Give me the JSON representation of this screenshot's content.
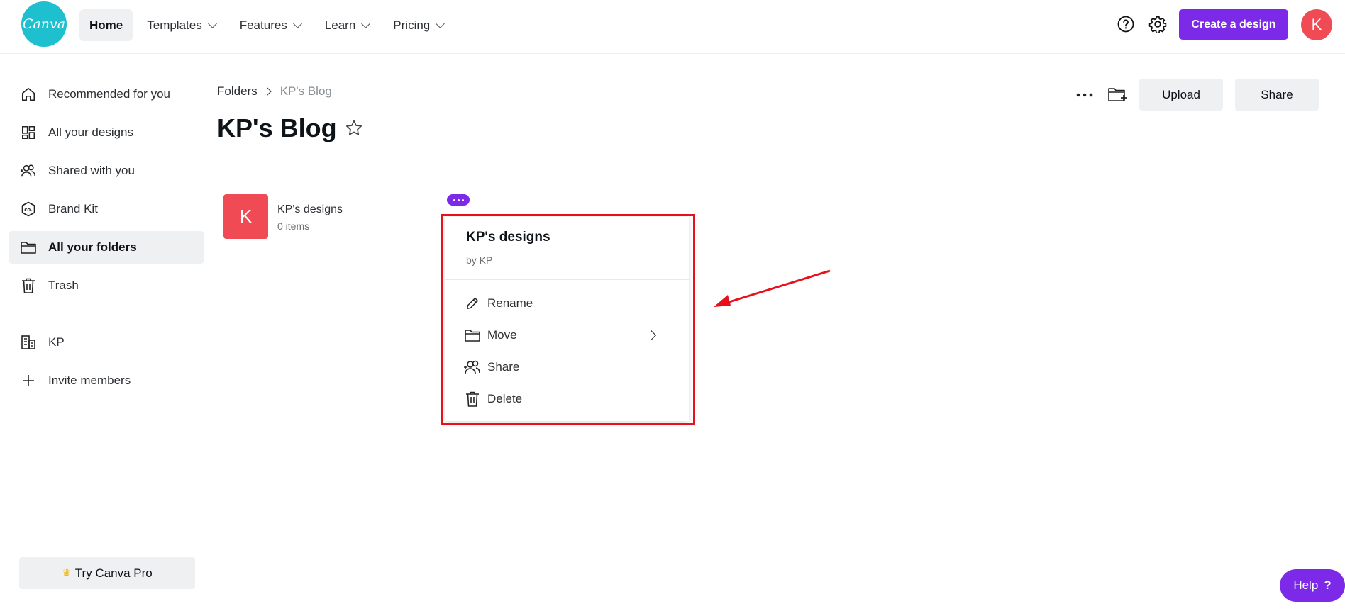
{
  "brand": {
    "logo_text": "Canva"
  },
  "nav": {
    "home": "Home",
    "templates": "Templates",
    "features": "Features",
    "learn": "Learn",
    "pricing": "Pricing"
  },
  "header": {
    "create_label": "Create a design",
    "avatar_initial": "K"
  },
  "sidebar": {
    "items": [
      {
        "label": "Recommended for you",
        "icon": "home-icon"
      },
      {
        "label": "All your designs",
        "icon": "grid-icon"
      },
      {
        "label": "Shared with you",
        "icon": "people-icon"
      },
      {
        "label": "Brand Kit",
        "icon": "brand-kit-icon"
      },
      {
        "label": "All your folders",
        "icon": "folder-icon"
      },
      {
        "label": "Trash",
        "icon": "trash-icon"
      }
    ],
    "team_label": "KP",
    "invite_label": "Invite members",
    "try_pro": "Try Canva Pro"
  },
  "breadcrumb": {
    "root": "Folders",
    "current": "KP's Blog"
  },
  "page": {
    "title": "KP's Blog"
  },
  "toolbar": {
    "upload": "Upload",
    "share": "Share"
  },
  "folder": {
    "initial": "K",
    "name": "KP's designs",
    "count": "0 items"
  },
  "menu": {
    "title": "KP's designs",
    "subtitle": "by KP",
    "items": {
      "rename": "Rename",
      "move": "Move",
      "share": "Share",
      "delete": "Delete"
    }
  },
  "help": {
    "label": "Help"
  },
  "colors": {
    "accent": "#7d2ae8",
    "logo": "#1ec0cf",
    "avatar": "#f04a55",
    "highlight": "#e8111b"
  }
}
